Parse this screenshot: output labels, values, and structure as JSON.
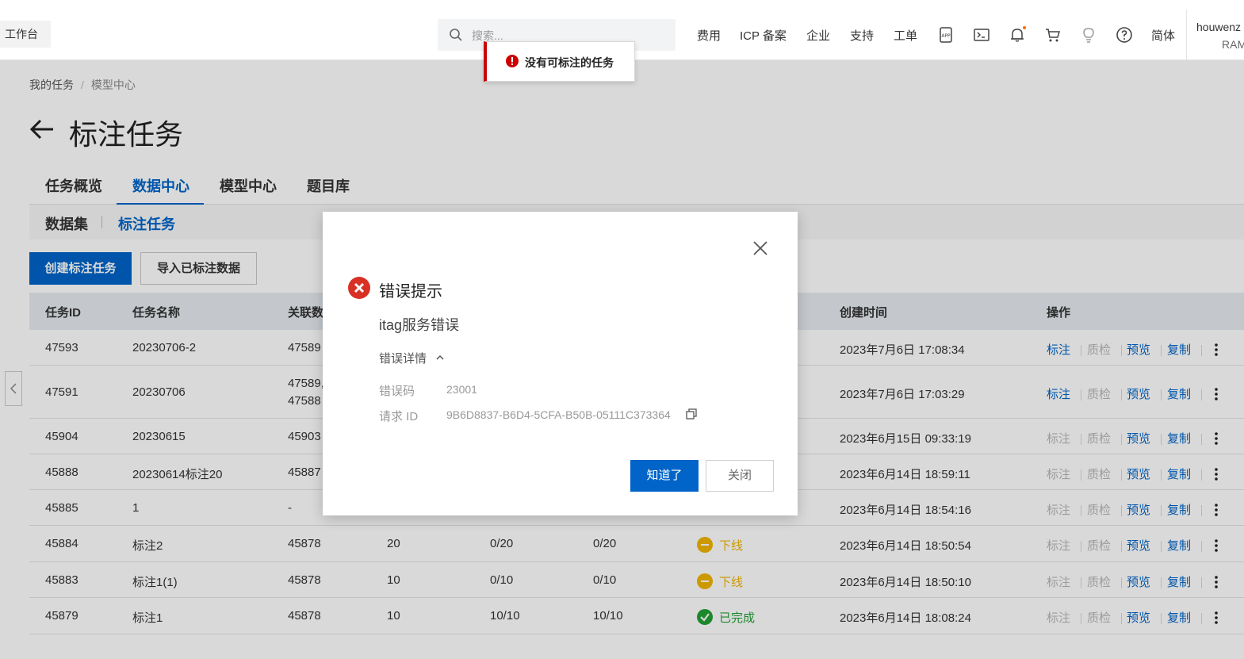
{
  "nav": {
    "workbench": "工作台",
    "search_placeholder": "搜索...",
    "items": [
      "费用",
      "ICP 备案",
      "企业",
      "支持",
      "工单"
    ],
    "lang": "简体",
    "user_name": "houwenz",
    "user_role": "RAM"
  },
  "toast": {
    "text": "没有可标注的任务"
  },
  "breadcrumb": [
    "我的任务",
    "模型中心"
  ],
  "page_title": "标注任务",
  "tabs": [
    "任务概览",
    "数据中心",
    "模型中心",
    "题目库"
  ],
  "subtabs": [
    "数据集",
    "标注任务"
  ],
  "buttons": {
    "create": "创建标注任务",
    "import": "导入已标注数据"
  },
  "table": {
    "headers": {
      "id": "任务ID",
      "name": "任务名称",
      "rel": "关联数",
      "created": "创建时间",
      "ops": "操作"
    },
    "ops_labels": [
      "标注",
      "质检",
      "预览",
      "复制"
    ],
    "rows": [
      {
        "id": "47593",
        "name": "20230706-2",
        "rel": "47589",
        "rel2": "",
        "c1": "",
        "c2": "",
        "c3": "",
        "status": "",
        "created": "2023年7月6日 17:08:34",
        "mark_enabled": true
      },
      {
        "id": "47591",
        "name": "20230706",
        "rel": "47589,",
        "rel2": "47588",
        "c1": "",
        "c2": "",
        "c3": "",
        "status": "",
        "created": "2023年7月6日 17:03:29",
        "mark_enabled": true
      },
      {
        "id": "45904",
        "name": "20230615",
        "rel": "45903",
        "rel2": "",
        "c1": "",
        "c2": "",
        "c3": "",
        "status": "",
        "created": "2023年6月15日 09:33:19",
        "mark_enabled": false
      },
      {
        "id": "45888",
        "name": "20230614标注20",
        "rel": "45887",
        "rel2": "",
        "c1": "",
        "c2": "",
        "c3": "",
        "status": "",
        "created": "2023年6月14日 18:59:11",
        "mark_enabled": false
      },
      {
        "id": "45885",
        "name": "1",
        "rel": "-",
        "rel2": "",
        "c1": "",
        "c2": "",
        "c3": "",
        "status": "",
        "created": "2023年6月14日 18:54:16",
        "mark_enabled": false
      },
      {
        "id": "45884",
        "name": "标注2",
        "rel": "45878",
        "rel2": "",
        "c1": "20",
        "c2": "0/20",
        "c3": "0/20",
        "status": "下线",
        "status_type": "offline",
        "created": "2023年6月14日 18:50:54",
        "mark_enabled": false
      },
      {
        "id": "45883",
        "name": "标注1(1)",
        "rel": "45878",
        "rel2": "",
        "c1": "10",
        "c2": "0/10",
        "c3": "0/10",
        "status": "下线",
        "status_type": "offline",
        "created": "2023年6月14日 18:50:10",
        "mark_enabled": false
      },
      {
        "id": "45879",
        "name": "标注1",
        "rel": "45878",
        "rel2": "",
        "c1": "10",
        "c2": "10/10",
        "c3": "10/10",
        "status": "已完成",
        "status_type": "done",
        "created": "2023年6月14日 18:08:24",
        "mark_enabled": false
      }
    ]
  },
  "dialog": {
    "title": "错误提示",
    "message": "itag服务错误",
    "details_label": "错误详情",
    "code_label": "错误码",
    "code_value": "23001",
    "request_label": "请求 ID",
    "request_value": "9B6D8837-B6D4-5CFA-B50B-05111C373364",
    "ok": "知道了",
    "close": "关闭"
  },
  "colors": {
    "primary": "#0064c8",
    "error": "#d93026",
    "warning": "#f0b400",
    "success": "#22a033"
  }
}
